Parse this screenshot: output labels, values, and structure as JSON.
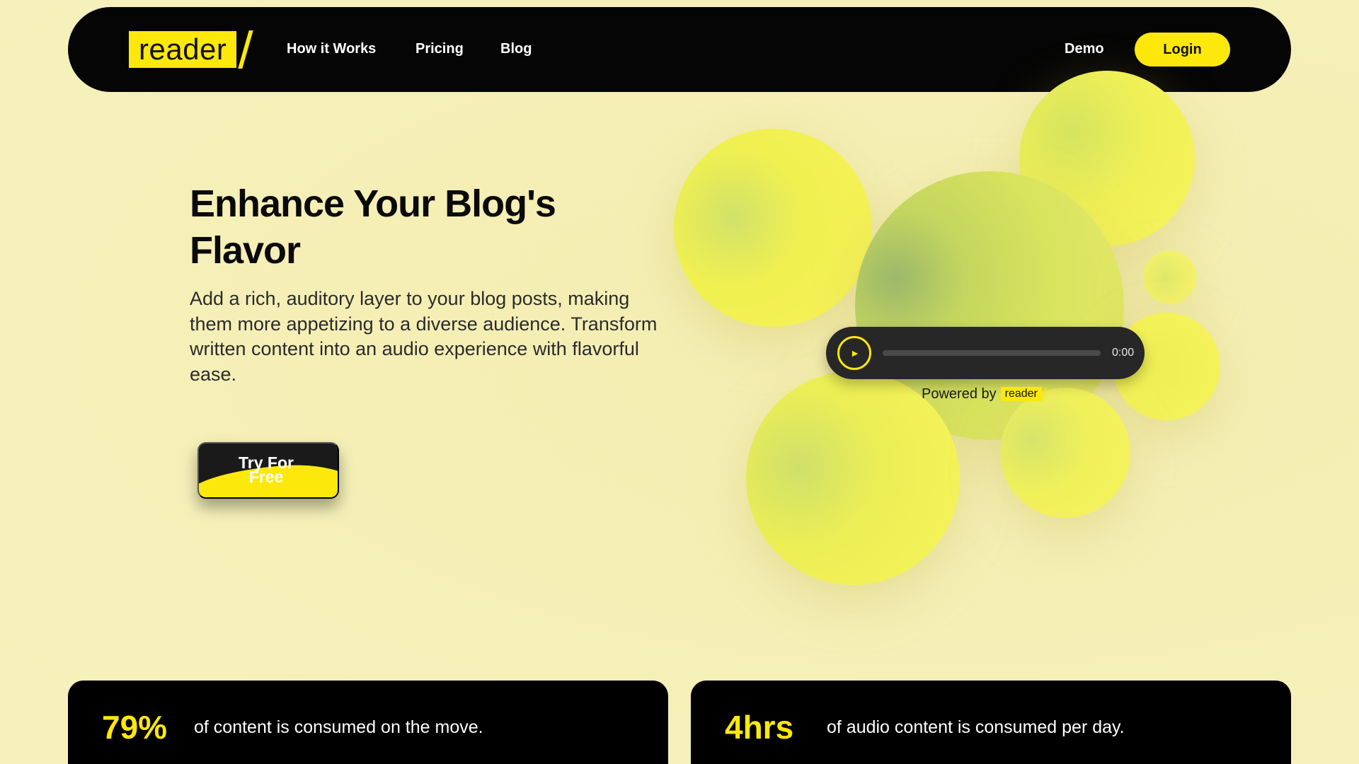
{
  "brand": {
    "logo_text": "reader",
    "accent_color": "#fde80b",
    "dark_color": "#050505",
    "background": "#f5efb8"
  },
  "nav": {
    "links": [
      "How it Works",
      "Pricing",
      "Blog"
    ],
    "demo": "Demo",
    "login": "Login"
  },
  "hero": {
    "title": "Enhance Your Blog's Flavor",
    "description": "Add a rich, auditory layer to your blog posts, making them more appetizing to a diverse audience. Transform written content into an audio experience with flavorful ease.",
    "cta": "Try For Free"
  },
  "player": {
    "play_icon": "play-icon",
    "progress": 0,
    "time": "0:00",
    "powered_by": "Powered by",
    "powered_logo": "reader"
  },
  "stats": [
    {
      "value": "79%",
      "text": "of content is consumed on the move."
    },
    {
      "value": "4hrs",
      "text": "of audio content is consumed per day."
    }
  ]
}
